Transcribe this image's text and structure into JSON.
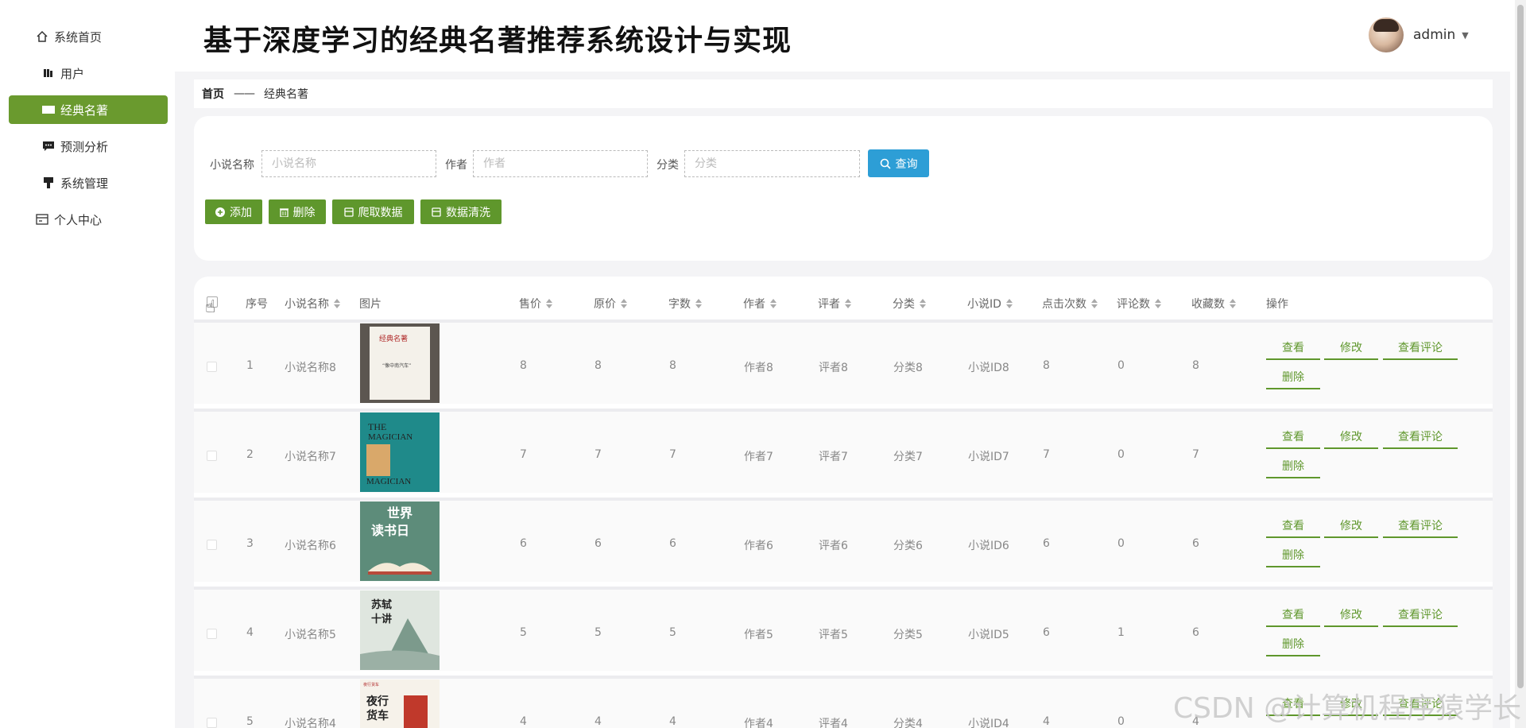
{
  "header": {
    "title": "基于深度学习的经典名著推荐系统设计与实现",
    "username": "admin"
  },
  "sidebar": {
    "items": [
      {
        "label": "系统首页",
        "icon": "home-icon"
      },
      {
        "label": "用户",
        "icon": "user-icon"
      },
      {
        "label": "经典名著",
        "icon": "book-icon"
      },
      {
        "label": "预测分析",
        "icon": "chat-icon"
      },
      {
        "label": "系统管理",
        "icon": "settings-icon"
      },
      {
        "label": "个人中心",
        "icon": "card-icon"
      }
    ],
    "active_color": "#6a9a2e"
  },
  "breadcrumb": {
    "home": "首页",
    "separator": "——",
    "current": "经典名著"
  },
  "search": {
    "name_label": "小说名称",
    "name_placeholder": "小说名称",
    "author_label": "作者",
    "author_placeholder": "作者",
    "category_label": "分类",
    "category_placeholder": "分类",
    "query_button": "查询"
  },
  "actions": {
    "add": "添加",
    "delete": "删除",
    "crawl": "爬取数据",
    "clean": "数据清洗"
  },
  "table": {
    "headers": [
      "序号",
      "小说名称",
      "图片",
      "售价",
      "原价",
      "字数",
      "作者",
      "评者",
      "分类",
      "小说ID",
      "点击次数",
      "评论数",
      "收藏数",
      "操作"
    ],
    "ops": {
      "view": "查看",
      "edit": "修改",
      "comments": "查看评论",
      "delete": "删除"
    },
    "rows": [
      {
        "index": "1",
        "name": "小说名称8",
        "price": "8",
        "orig_price": "8",
        "words": "8",
        "author": "作者8",
        "reviewer": "评者8",
        "category": "分类8",
        "novel_id": "小说ID8",
        "clicks": "8",
        "comments": "0",
        "favorites": "8",
        "cover_title": "经典名著"
      },
      {
        "index": "2",
        "name": "小说名称7",
        "price": "7",
        "orig_price": "7",
        "words": "7",
        "author": "作者7",
        "reviewer": "评者7",
        "category": "分类7",
        "novel_id": "小说ID7",
        "clicks": "7",
        "comments": "0",
        "favorites": "7",
        "cover_title": "THE MAGICIAN"
      },
      {
        "index": "3",
        "name": "小说名称6",
        "price": "6",
        "orig_price": "6",
        "words": "6",
        "author": "作者6",
        "reviewer": "评者6",
        "category": "分类6",
        "novel_id": "小说ID6",
        "clicks": "6",
        "comments": "0",
        "favorites": "6",
        "cover_title": "世界读书日"
      },
      {
        "index": "4",
        "name": "小说名称5",
        "price": "5",
        "orig_price": "5",
        "words": "5",
        "author": "作者5",
        "reviewer": "评者5",
        "category": "分类5",
        "novel_id": "小说ID5",
        "clicks": "6",
        "comments": "1",
        "favorites": "6",
        "cover_title": "苏轼十讲"
      },
      {
        "index": "5",
        "name": "小说名称4",
        "price": "4",
        "orig_price": "4",
        "words": "4",
        "author": "作者4",
        "reviewer": "评者4",
        "category": "分类4",
        "novel_id": "小说ID4",
        "clicks": "4",
        "comments": "0",
        "favorites": "4",
        "cover_title": "夜行货车"
      }
    ]
  },
  "watermark": "CSDN @计算机程序猿学长"
}
